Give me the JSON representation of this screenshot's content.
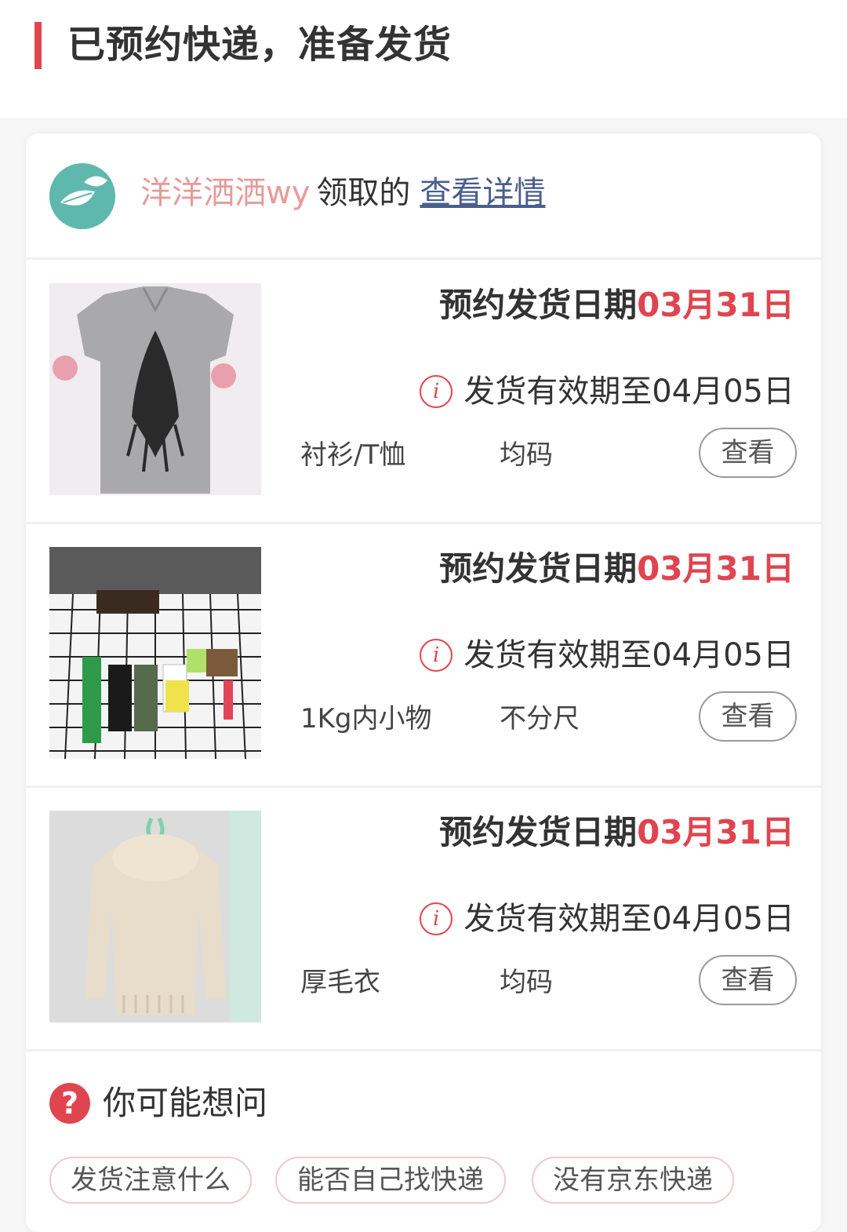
{
  "header": {
    "title": "已预约快递，准备发货"
  },
  "claim": {
    "claimer_name": "洋洋洒洒wy",
    "verb": "领取的",
    "detail_link": "查看详情"
  },
  "items": [
    {
      "ship_label": "预约发货日期",
      "ship_date": "03月31日",
      "validity": "发货有效期至04月05日",
      "category": "衬衫/T恤",
      "size": "均码",
      "view_button": "查看"
    },
    {
      "ship_label": "预约发货日期",
      "ship_date": "03月31日",
      "validity": "发货有效期至04月05日",
      "category": "1Kg内小物",
      "size": "不分尺",
      "view_button": "查看"
    },
    {
      "ship_label": "预约发货日期",
      "ship_date": "03月31日",
      "validity": "发货有效期至04月05日",
      "category": "厚毛衣",
      "size": "均码",
      "view_button": "查看"
    }
  ],
  "faq": {
    "title": "你可能想问",
    "chips": [
      "发货注意什么",
      "能否自己找快递",
      "没有京东快递"
    ]
  },
  "icons": {
    "info": "info-icon",
    "question": "question-icon",
    "avatar": "leaf-avatar"
  },
  "colors": {
    "accent": "#e0454f",
    "claimer_name": "#e89a9a",
    "link": "#4a5e8c",
    "avatar_bg": "#5fb8ad"
  }
}
